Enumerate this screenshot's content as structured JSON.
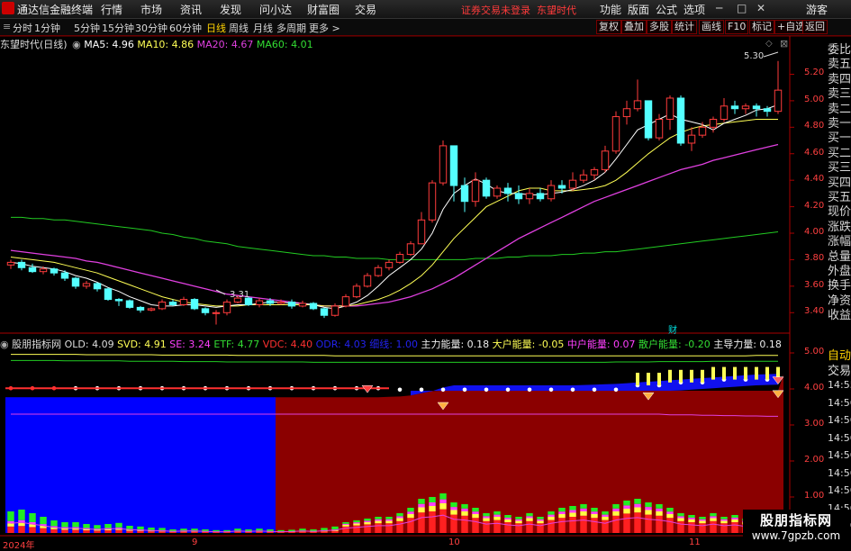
{
  "app": {
    "title": "通达信金融终端"
  },
  "menu": [
    "行情",
    "市场",
    "资讯",
    "发现",
    "问小达",
    "财富圈",
    "交易"
  ],
  "warning": "证券交易未登录",
  "stock_name_top": "东望时代",
  "right_menu": [
    "功能",
    "版面",
    "公式",
    "选项"
  ],
  "user": "游客",
  "periods": [
    "分时",
    "1分钟",
    "5分钟",
    "15分钟",
    "30分钟",
    "60分钟",
    "日线",
    "周线",
    "月线",
    "多周期",
    "更多"
  ],
  "active_period": "日线",
  "toolbar_right": [
    "复权",
    "叠加",
    "多股",
    "统计",
    "画线",
    "F10",
    "标记",
    "+自选",
    "返回"
  ],
  "price_header": {
    "title": "东望时代(日线)",
    "ma5": "MA5: 4.96",
    "ma10": "MA10: 4.86",
    "ma20": "MA20: 4.67",
    "ma60": "MA60: 4.01"
  },
  "high_label": "5.30",
  "low_label": "3.31",
  "event_label": "财",
  "price_axis": [
    "5.20",
    "5.00",
    "4.80",
    "4.60",
    "4.40",
    "4.20",
    "4.00",
    "3.80",
    "3.60",
    "3.40"
  ],
  "indicator_header": {
    "title": "股朋指标网",
    "old": "OLD: 4.09",
    "svd": "SVD: 4.91",
    "se": "SE: 3.24",
    "etf": "ETF: 4.77",
    "vdc": "VDC: 4.40",
    "odr": "ODR: 4.03",
    "hf": "细线: 1.00",
    "zl": "主力能量: 0.18",
    "dh": "大户能量: -0.05",
    "zh": "中户能量: 0.07",
    "sh": "散户能量: -0.20",
    "zd": "主导力量: 0.18"
  },
  "ind_axis": [
    "5.00",
    "4.00",
    "3.00",
    "2.00",
    "1.00"
  ],
  "date_axis": [
    "2024年",
    "9",
    "10",
    "11"
  ],
  "right_panel": [
    "委比",
    "卖五",
    "卖四",
    "卖三",
    "卖二",
    "卖一",
    "买一",
    "买二",
    "买三",
    "买四",
    "买五",
    "现价",
    "涨跌",
    "涨幅",
    "总量",
    "外盘",
    "换手",
    "净资",
    "收益"
  ],
  "right_panel2": [
    "自动",
    "交易"
  ],
  "times": [
    "14:55",
    "14:56",
    "14:56",
    "14:56",
    "14:56",
    "14:56",
    "14:56",
    "14:56",
    "14:56"
  ],
  "watermark": {
    "line1": "股朋指标网",
    "line2": "www.7gpzb.com"
  },
  "colors": {
    "up": "#ff3c3c",
    "down": "#54ffff",
    "ma5": "#ffffff",
    "ma10": "#ffff55",
    "ma20": "#e040e0",
    "ma60": "#22cc22",
    "bg": "#000000",
    "panel_red": "#8b0000",
    "panel_blue": "#0000ff"
  },
  "chart_data": {
    "type": "candlestick",
    "title": "东望时代(日线)",
    "ylim": [
      3.3,
      5.38
    ],
    "candles": [
      [
        3.76,
        3.78,
        3.8,
        3.73
      ],
      [
        3.78,
        3.74,
        3.8,
        3.72
      ],
      [
        3.74,
        3.71,
        3.77,
        3.7
      ],
      [
        3.71,
        3.73,
        3.75,
        3.69
      ],
      [
        3.73,
        3.7,
        3.74,
        3.68
      ],
      [
        3.7,
        3.66,
        3.72,
        3.64
      ],
      [
        3.66,
        3.6,
        3.67,
        3.58
      ],
      [
        3.6,
        3.62,
        3.64,
        3.58
      ],
      [
        3.62,
        3.58,
        3.63,
        3.56
      ],
      [
        3.58,
        3.5,
        3.59,
        3.49
      ],
      [
        3.5,
        3.49,
        3.51,
        3.45
      ],
      [
        3.49,
        3.44,
        3.5,
        3.43
      ],
      [
        3.44,
        3.42,
        3.45,
        3.4
      ],
      [
        3.42,
        3.43,
        3.44,
        3.41
      ],
      [
        3.43,
        3.48,
        3.5,
        3.42
      ],
      [
        3.48,
        3.46,
        3.5,
        3.45
      ],
      [
        3.46,
        3.5,
        3.52,
        3.45
      ],
      [
        3.5,
        3.43,
        3.51,
        3.42
      ],
      [
        3.43,
        3.4,
        3.44,
        3.38
      ],
      [
        3.4,
        3.4,
        3.42,
        3.31
      ],
      [
        3.4,
        3.48,
        3.5,
        3.38
      ],
      [
        3.48,
        3.51,
        3.53,
        3.47
      ],
      [
        3.51,
        3.46,
        3.52,
        3.45
      ],
      [
        3.46,
        3.49,
        3.51,
        3.44
      ],
      [
        3.49,
        3.47,
        3.51,
        3.45
      ],
      [
        3.47,
        3.48,
        3.5,
        3.46
      ],
      [
        3.48,
        3.45,
        3.5,
        3.43
      ],
      [
        3.45,
        3.47,
        3.49,
        3.44
      ],
      [
        3.47,
        3.43,
        3.48,
        3.42
      ],
      [
        3.43,
        3.38,
        3.44,
        3.36
      ],
      [
        3.38,
        3.45,
        3.47,
        3.37
      ],
      [
        3.45,
        3.52,
        3.54,
        3.44
      ],
      [
        3.52,
        3.6,
        3.62,
        3.51
      ],
      [
        3.6,
        3.68,
        3.7,
        3.59
      ],
      [
        3.68,
        3.74,
        3.76,
        3.67
      ],
      [
        3.74,
        3.78,
        3.8,
        3.72
      ],
      [
        3.78,
        3.84,
        3.86,
        3.77
      ],
      [
        3.84,
        3.92,
        3.94,
        3.83
      ],
      [
        3.92,
        4.1,
        4.16,
        3.92
      ],
      [
        4.1,
        4.38,
        4.4,
        4.08
      ],
      [
        4.38,
        4.66,
        4.7,
        4.36
      ],
      [
        4.66,
        4.36,
        4.66,
        4.24
      ],
      [
        4.36,
        4.24,
        4.42,
        4.16
      ],
      [
        4.24,
        4.4,
        4.46,
        4.2
      ],
      [
        4.4,
        4.28,
        4.42,
        4.26
      ],
      [
        4.28,
        4.34,
        4.36,
        4.26
      ],
      [
        4.34,
        4.3,
        4.38,
        4.24
      ],
      [
        4.3,
        4.26,
        4.36,
        4.22
      ],
      [
        4.26,
        4.3,
        4.34,
        4.22
      ],
      [
        4.3,
        4.26,
        4.34,
        4.24
      ],
      [
        4.26,
        4.36,
        4.4,
        4.24
      ],
      [
        4.36,
        4.34,
        4.4,
        4.3
      ],
      [
        4.34,
        4.4,
        4.46,
        4.32
      ],
      [
        4.4,
        4.44,
        4.48,
        4.38
      ],
      [
        4.44,
        4.48,
        4.5,
        4.4
      ],
      [
        4.48,
        4.62,
        4.66,
        4.46
      ],
      [
        4.62,
        4.88,
        4.92,
        4.6
      ],
      [
        4.88,
        4.94,
        5.0,
        4.82
      ],
      [
        4.94,
        5.0,
        5.16,
        4.92
      ],
      [
        5.0,
        4.72,
        5.0,
        4.7
      ],
      [
        4.72,
        4.86,
        4.9,
        4.7
      ],
      [
        4.86,
        5.02,
        5.04,
        4.78
      ],
      [
        5.02,
        4.68,
        5.04,
        4.66
      ],
      [
        4.68,
        4.74,
        4.8,
        4.62
      ],
      [
        4.74,
        4.8,
        4.84,
        4.72
      ],
      [
        4.8,
        4.86,
        4.88,
        4.76
      ],
      [
        4.86,
        4.96,
        5.02,
        4.84
      ],
      [
        4.96,
        4.94,
        5.0,
        4.9
      ],
      [
        4.94,
        4.96,
        4.98,
        4.9
      ],
      [
        4.96,
        4.94,
        4.98,
        4.88
      ],
      [
        4.94,
        4.92,
        4.96,
        4.88
      ],
      [
        4.92,
        5.08,
        5.3,
        4.9
      ]
    ],
    "ma5": [
      3.78,
      3.77,
      3.75,
      3.74,
      3.73,
      3.71,
      3.68,
      3.66,
      3.63,
      3.59,
      3.56,
      3.52,
      3.49,
      3.46,
      3.45,
      3.45,
      3.46,
      3.46,
      3.45,
      3.44,
      3.45,
      3.46,
      3.46,
      3.47,
      3.48,
      3.48,
      3.47,
      3.47,
      3.46,
      3.44,
      3.43,
      3.45,
      3.48,
      3.53,
      3.6,
      3.68,
      3.74,
      3.8,
      3.88,
      4.0,
      4.18,
      4.3,
      4.36,
      4.41,
      4.37,
      4.32,
      4.3,
      4.3,
      4.29,
      4.29,
      4.3,
      4.31,
      4.33,
      4.36,
      4.4,
      4.46,
      4.56,
      4.67,
      4.78,
      4.82,
      4.86,
      4.9,
      4.86,
      4.84,
      4.82,
      4.78,
      4.83,
      4.86,
      4.89,
      4.93,
      4.94,
      4.97
    ],
    "ma10": [
      3.82,
      3.81,
      3.8,
      3.79,
      3.78,
      3.76,
      3.74,
      3.72,
      3.7,
      3.67,
      3.64,
      3.61,
      3.58,
      3.55,
      3.52,
      3.5,
      3.48,
      3.47,
      3.46,
      3.45,
      3.45,
      3.45,
      3.46,
      3.46,
      3.46,
      3.46,
      3.46,
      3.46,
      3.46,
      3.45,
      3.45,
      3.45,
      3.46,
      3.48,
      3.5,
      3.53,
      3.57,
      3.62,
      3.68,
      3.76,
      3.86,
      3.96,
      4.04,
      4.12,
      4.2,
      4.24,
      4.28,
      4.32,
      4.34,
      4.34,
      4.32,
      4.32,
      4.32,
      4.33,
      4.34,
      4.36,
      4.4,
      4.46,
      4.53,
      4.6,
      4.66,
      4.72,
      4.76,
      4.79,
      4.81,
      4.82,
      4.83,
      4.84,
      4.85,
      4.86,
      4.86,
      4.86
    ],
    "ma20": [
      3.87,
      3.86,
      3.85,
      3.84,
      3.83,
      3.82,
      3.81,
      3.79,
      3.78,
      3.76,
      3.74,
      3.72,
      3.7,
      3.68,
      3.66,
      3.64,
      3.62,
      3.6,
      3.58,
      3.56,
      3.54,
      3.53,
      3.52,
      3.51,
      3.5,
      3.49,
      3.48,
      3.47,
      3.46,
      3.45,
      3.45,
      3.45,
      3.45,
      3.46,
      3.47,
      3.48,
      3.5,
      3.52,
      3.55,
      3.58,
      3.62,
      3.66,
      3.71,
      3.76,
      3.81,
      3.86,
      3.91,
      3.96,
      4.0,
      4.04,
      4.08,
      4.12,
      4.16,
      4.2,
      4.24,
      4.27,
      4.3,
      4.33,
      4.36,
      4.39,
      4.42,
      4.45,
      4.48,
      4.5,
      4.52,
      4.55,
      4.57,
      4.59,
      4.61,
      4.63,
      4.65,
      4.67
    ],
    "ma60": [
      4.12,
      4.12,
      4.11,
      4.11,
      4.1,
      4.1,
      4.09,
      4.08,
      4.07,
      4.06,
      4.05,
      4.04,
      4.03,
      4.02,
      4.0,
      3.99,
      3.97,
      3.96,
      3.94,
      3.93,
      3.92,
      3.9,
      3.89,
      3.88,
      3.87,
      3.86,
      3.85,
      3.84,
      3.83,
      3.83,
      3.82,
      3.82,
      3.81,
      3.81,
      3.81,
      3.8,
      3.8,
      3.8,
      3.8,
      3.8,
      3.8,
      3.8,
      3.8,
      3.81,
      3.81,
      3.81,
      3.82,
      3.82,
      3.83,
      3.83,
      3.83,
      3.84,
      3.84,
      3.85,
      3.85,
      3.86,
      3.86,
      3.87,
      3.88,
      3.89,
      3.9,
      3.91,
      3.92,
      3.93,
      3.94,
      3.95,
      3.96,
      3.97,
      3.98,
      3.99,
      4.0,
      4.01
    ],
    "indicator": {
      "ylim": [
        0,
        5.2
      ],
      "blue_cut": 24,
      "yellow_line": [
        4.96,
        4.96,
        4.96,
        4.96,
        4.96,
        4.96,
        4.96,
        4.95,
        4.95,
        4.95,
        4.95,
        4.95,
        4.95,
        4.95,
        4.94,
        4.94,
        4.94,
        4.94,
        4.94,
        4.94,
        4.94,
        4.93,
        4.93,
        4.93,
        4.93,
        4.93,
        4.93,
        4.93,
        4.93,
        4.93,
        4.92,
        4.92,
        4.92,
        4.92,
        4.92,
        4.92,
        4.92,
        4.92,
        4.92,
        4.92,
        4.92,
        4.92,
        4.92,
        4.92,
        4.92,
        4.92,
        4.92,
        4.92,
        4.92,
        4.92,
        4.92,
        4.92,
        4.92,
        4.92,
        4.92,
        4.92,
        4.92,
        4.92,
        4.92,
        4.92,
        4.92,
        4.92,
        4.92,
        4.92,
        4.92,
        4.92,
        4.92,
        4.92,
        4.92,
        4.93,
        4.93,
        4.93
      ],
      "green_line": [
        4.79,
        4.79,
        4.79,
        4.79,
        4.79,
        4.78,
        4.78,
        4.78,
        4.78,
        4.78,
        4.78,
        4.77,
        4.77,
        4.77,
        4.77,
        4.77,
        4.76,
        4.76,
        4.76,
        4.76,
        4.75,
        4.75,
        4.75,
        4.75,
        4.75,
        4.75,
        4.75,
        4.75,
        4.74,
        4.74,
        4.74,
        4.74,
        4.74,
        4.74,
        4.74,
        4.74,
        4.74,
        4.74,
        4.74,
        4.74,
        4.74,
        4.74,
        4.74,
        4.74,
        4.74,
        4.74,
        4.74,
        4.74,
        4.74,
        4.74,
        4.74,
        4.74,
        4.74,
        4.74,
        4.74,
        4.74,
        4.75,
        4.75,
        4.75,
        4.75,
        4.76,
        4.76,
        4.76,
        4.76,
        4.76,
        4.77,
        4.77,
        4.77,
        4.77,
        4.77,
        4.77,
        4.77
      ],
      "magenta_line": [
        3.3,
        3.3,
        3.3,
        3.3,
        3.3,
        3.3,
        3.3,
        3.3,
        3.3,
        3.3,
        3.3,
        3.3,
        3.3,
        3.3,
        3.3,
        3.3,
        3.3,
        3.3,
        3.3,
        3.3,
        3.3,
        3.3,
        3.3,
        3.3,
        3.3,
        3.3,
        3.3,
        3.3,
        3.3,
        3.3,
        3.3,
        3.3,
        3.3,
        3.3,
        3.3,
        3.3,
        3.3,
        3.3,
        3.3,
        3.3,
        3.3,
        3.3,
        3.3,
        3.3,
        3.3,
        3.3,
        3.3,
        3.3,
        3.3,
        3.3,
        3.3,
        3.3,
        3.3,
        3.3,
        3.3,
        3.3,
        3.3,
        3.3,
        3.3,
        3.3,
        3.3,
        3.28,
        3.28,
        3.28,
        3.27,
        3.27,
        3.26,
        3.26,
        3.25,
        3.25,
        3.24,
        3.24
      ],
      "blue_top": [
        4.0,
        4.0,
        4.0,
        4.0,
        4.0,
        4.0,
        4.0,
        4.0,
        3.98,
        3.96,
        3.94,
        3.92,
        3.9,
        3.88,
        3.86,
        3.85,
        3.84,
        3.82,
        3.8,
        3.79,
        3.78,
        3.78,
        3.77,
        3.77,
        3.77,
        3.77,
        3.77,
        3.77,
        3.77,
        3.77,
        3.77,
        3.77,
        3.77,
        3.77,
        3.77,
        3.78,
        3.79,
        3.82,
        3.88,
        3.94,
        4.04,
        4.1,
        4.1,
        4.1,
        4.1,
        4.1,
        4.1,
        4.1,
        4.1,
        4.1,
        4.1,
        4.1,
        4.1,
        4.11,
        4.12,
        4.13,
        4.14,
        4.16,
        4.18,
        4.2,
        4.22,
        4.24,
        4.26,
        4.28,
        4.3,
        4.32,
        4.34,
        4.36,
        4.38,
        4.4,
        4.41,
        4.42
      ],
      "dots": [
        4.02,
        4.02,
        4.02,
        4.02,
        4.02,
        4.02,
        4.02,
        4.02,
        4.02,
        4.02,
        4.02,
        4.02,
        4.02,
        4.02,
        4.02,
        4.02,
        4.02,
        4.02,
        4.02,
        4.02,
        4.02,
        4.02,
        4.02,
        4.02,
        4.02,
        4.02,
        4.02,
        4.02,
        4.02,
        4.02,
        4.02,
        4.02,
        4.02,
        4.02,
        4.02,
        4.02,
        3.98,
        3.98,
        3.98,
        3.98,
        3.98,
        3.98,
        3.98,
        3.98,
        3.98,
        3.98,
        3.98,
        3.98,
        3.98,
        3.98,
        3.98,
        3.98,
        3.98,
        3.98,
        3.98,
        3.98,
        3.98,
        4.1,
        4.1,
        4.1,
        4.1,
        4.18,
        4.18,
        4.18,
        4.18,
        4.26,
        4.26,
        4.26,
        4.26,
        4.26,
        4.26,
        4.26
      ],
      "volume": [
        0.6,
        0.65,
        0.55,
        0.45,
        0.35,
        0.3,
        0.3,
        0.25,
        0.22,
        0.25,
        0.28,
        0.2,
        0.18,
        0.15,
        0.14,
        0.1,
        0.12,
        0.12,
        0.1,
        0.08,
        0.08,
        0.12,
        0.1,
        0.12,
        0.1,
        0.08,
        0.09,
        0.12,
        0.1,
        0.14,
        0.18,
        0.3,
        0.35,
        0.4,
        0.45,
        0.45,
        0.55,
        0.7,
        0.95,
        1.0,
        1.1,
        0.85,
        0.8,
        0.7,
        0.55,
        0.6,
        0.5,
        0.45,
        0.55,
        0.45,
        0.6,
        0.7,
        0.75,
        0.8,
        0.7,
        0.6,
        0.8,
        0.9,
        0.95,
        0.85,
        0.8,
        0.7,
        0.55,
        0.5,
        0.45,
        0.55,
        0.45,
        0.5,
        0.4,
        0.45,
        0.35,
        0.4
      ]
    }
  }
}
